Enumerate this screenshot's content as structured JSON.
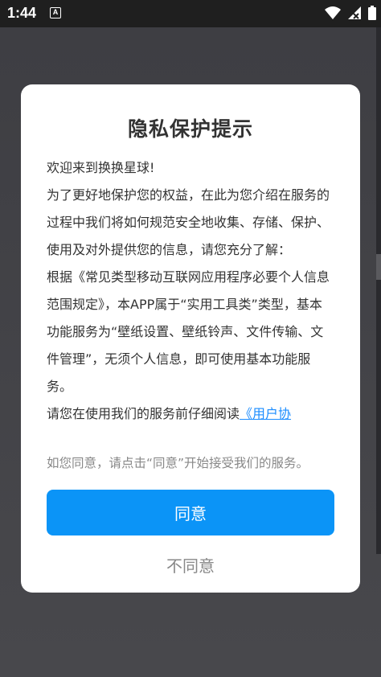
{
  "status_bar": {
    "time": "1:44",
    "notification_badge": "A",
    "icons": [
      "wifi-icon",
      "signal-icon",
      "battery-icon"
    ]
  },
  "dialog": {
    "title": "隐私保护提示",
    "paragraphs": {
      "welcome": "欢迎来到换换星球!",
      "intro": "为了更好地保护您的权益，在此为您介绍在服务的过程中我们将如何规范安全地收集、存储、保护、使用及对外提供您的信息，请您充分了解：",
      "basis": "根据《常见类型移动互联网应用程序必要个人信息范围规定》，本APP属于“实用工具类”类型，基本功能服务为“壁纸设置、壁纸铃声、文件传输、文件管理”，无须个人信息，即可使用基本功能服务。",
      "read_prompt": "请您在使用我们的服务前仔细阅读",
      "read_link": "《用户协"
    },
    "consent_hint": "如您同意，请点击“同意”开始接受我们的服务。",
    "agree_label": "同意",
    "disagree_label": "不同意"
  },
  "colors": {
    "accent": "#0b94f7",
    "link": "#1a8cff",
    "overlay": "#4a4a4e"
  }
}
